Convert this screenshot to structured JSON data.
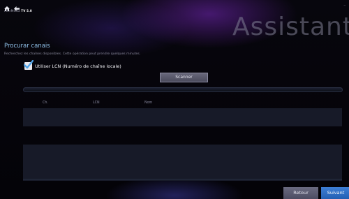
{
  "app": {
    "name_prefix": "AVerMedia ",
    "name_bold": "TV 5.0",
    "window_control": "_"
  },
  "nav": {
    "home_icon": "home-icon",
    "back_icon": "back-arrow-icon"
  },
  "assistant_title": "Assistant",
  "page": {
    "heading": "Procurar canais",
    "instructions": "Recherchez les chaînes disponibles. Cette opération peut prendre quelques minutes."
  },
  "lcn": {
    "checked": true,
    "label": "Utiliser LCN (Numéro de chaîne locale)"
  },
  "scan_button": "Scanner",
  "progress": {
    "fraction": 0
  },
  "table": {
    "columns": [
      "Ch.",
      "LCN",
      "Nom"
    ],
    "rows": []
  },
  "buttons": {
    "back": "Retour",
    "next": "Suivant"
  },
  "colors": {
    "heading": "#8fc0e8",
    "primary_button": "#3e7fd6"
  }
}
